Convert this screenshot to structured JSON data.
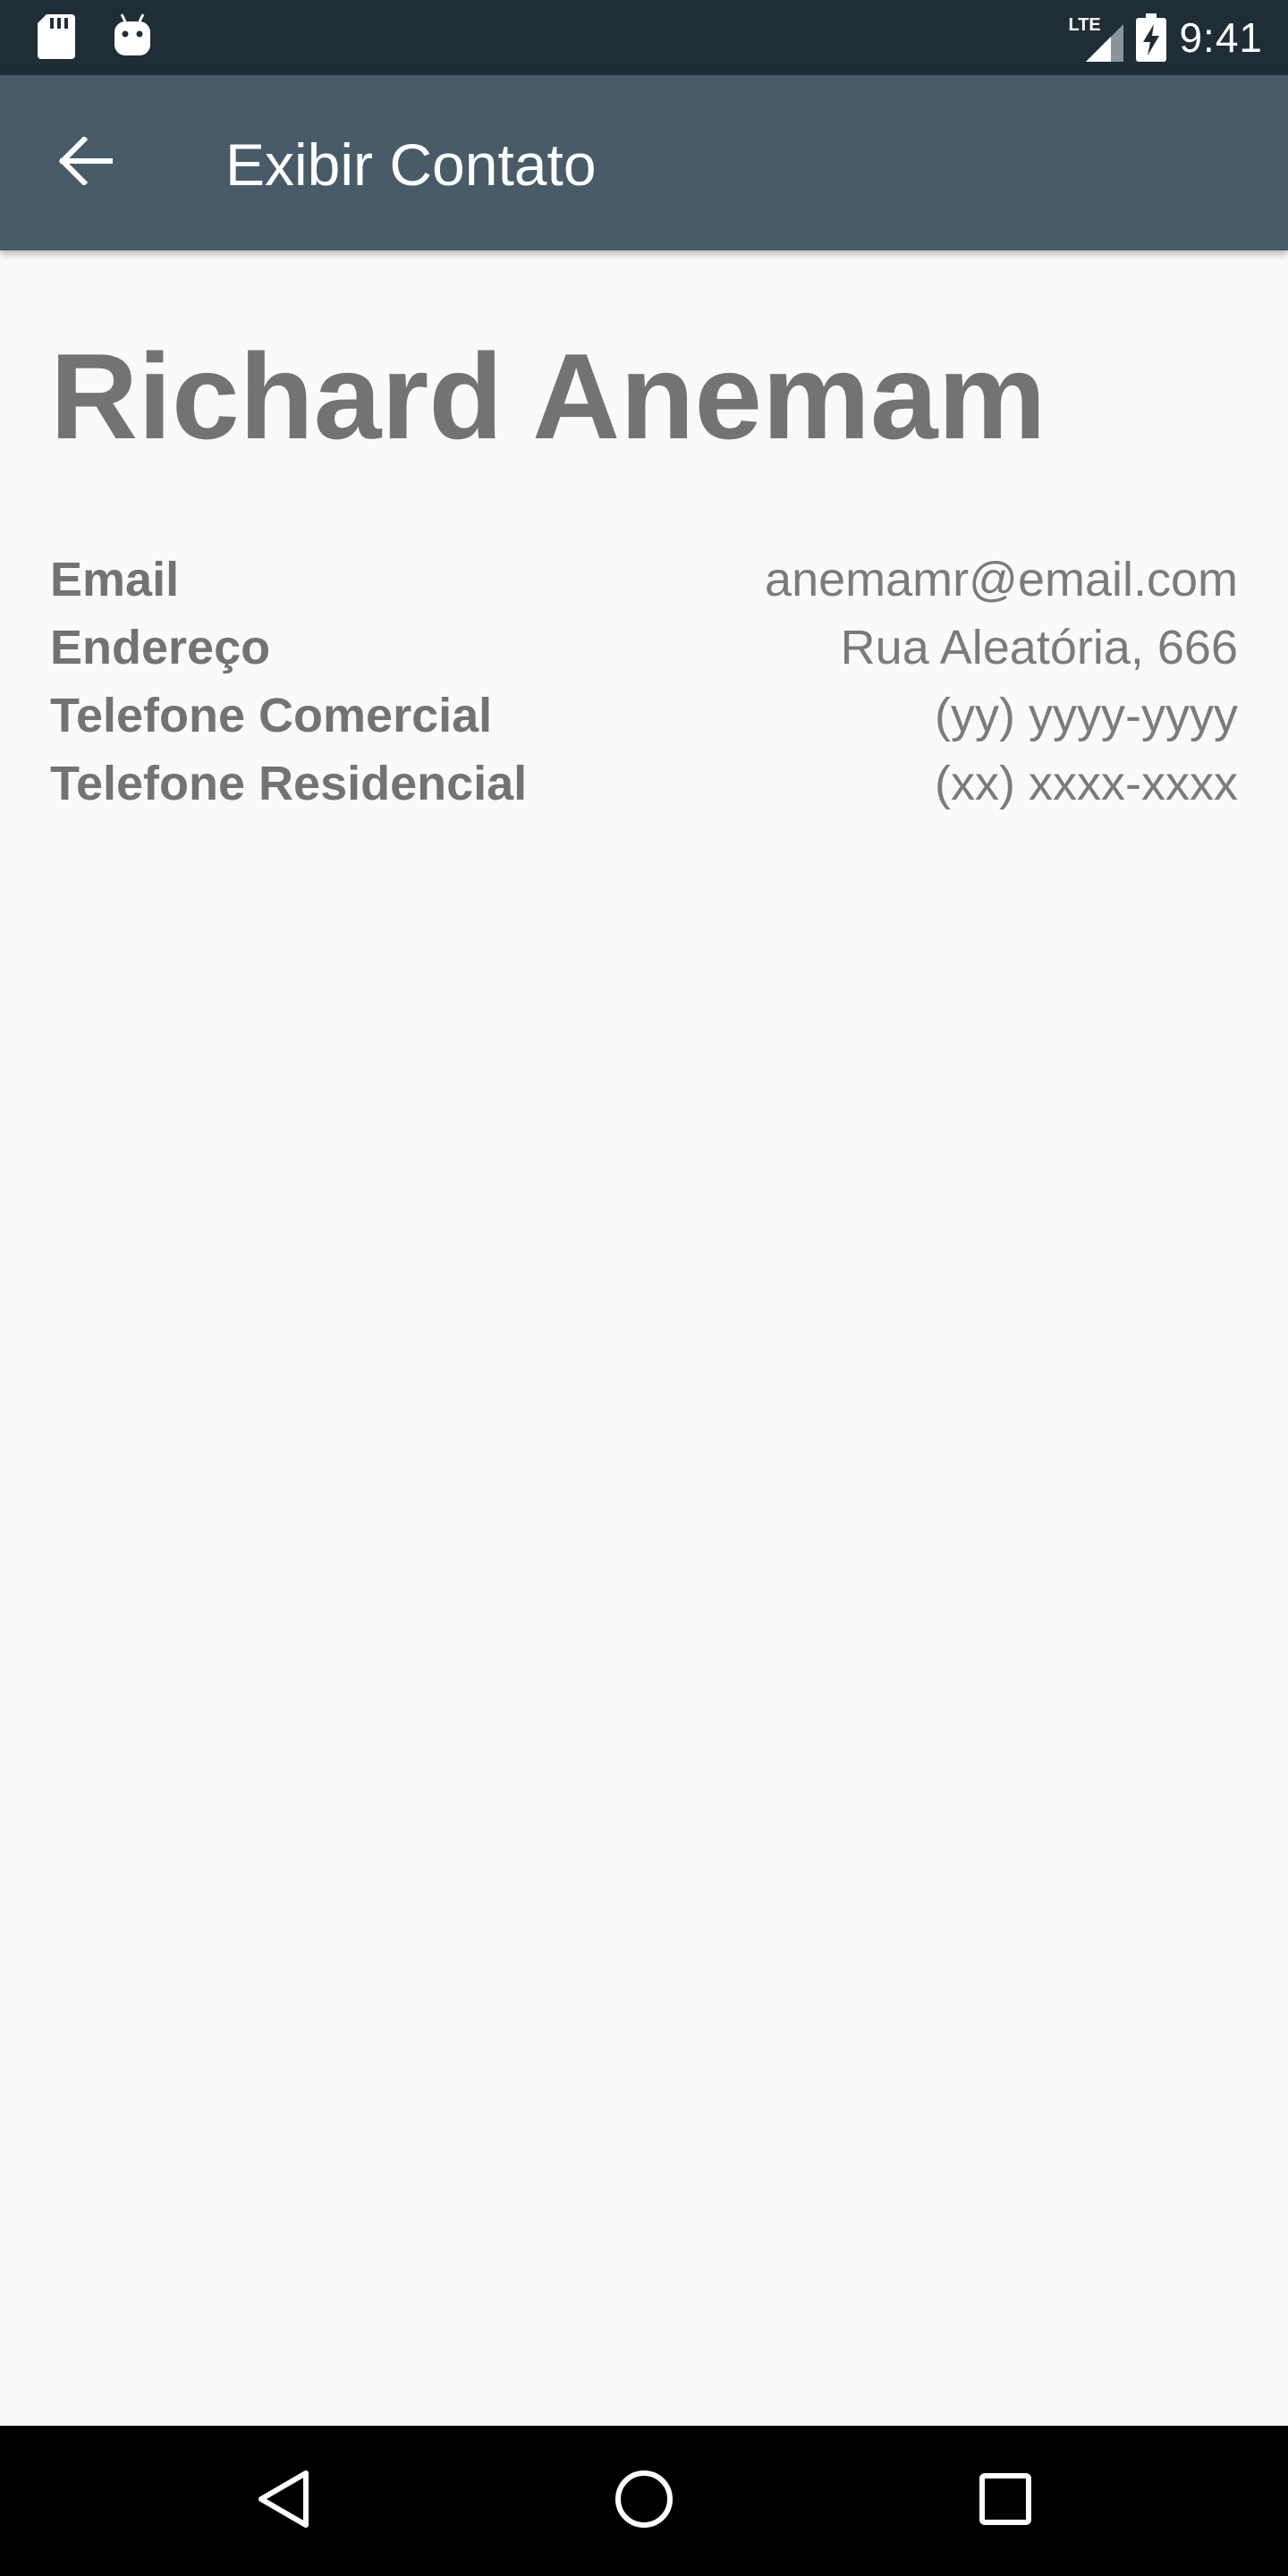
{
  "status_bar": {
    "time": "9:41",
    "network_label": "LTE",
    "icons": [
      "sd-card-icon",
      "android-debug-icon",
      "lte-signal-icon",
      "battery-charging-icon"
    ]
  },
  "app_bar": {
    "title": "Exibir Contato",
    "back_icon": "arrow-back-icon"
  },
  "contact": {
    "name": "Richard Anemam",
    "fields": [
      {
        "label": "Email",
        "value": "anemamr@email.com"
      },
      {
        "label": "Endereço",
        "value": "Rua Aleatória, 666"
      },
      {
        "label": "Telefone Comercial",
        "value": "(yy) yyyy-yyyy"
      },
      {
        "label": "Telefone Residencial",
        "value": "(xx) xxxx-xxxx"
      }
    ]
  },
  "nav_bar": {
    "icons": [
      "nav-back-icon",
      "nav-home-icon",
      "nav-recents-icon"
    ]
  },
  "colors": {
    "status_bar": "#1f2d37",
    "app_bar": "#485b68",
    "background": "#fafafa",
    "text": "#737373",
    "nav_bar": "#000000"
  }
}
